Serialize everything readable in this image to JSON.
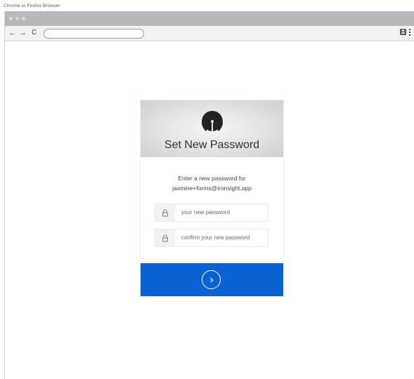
{
  "caption": "Chrome or Firefox Browser",
  "browser": {
    "nav": {
      "back": "←",
      "forward": "→",
      "reload": "C"
    },
    "url": ""
  },
  "card": {
    "title": "Set New Password",
    "desc_line1": "Enter a new password for",
    "desc_line2": "jasmine+forms@ironsight.app",
    "password_placeholder": "your new password",
    "confirm_placeholder": "confirm your new password"
  },
  "colors": {
    "accent": "#0b62d2",
    "header_bg": "#dcdcdc",
    "titlebar": "#b6b8bd"
  },
  "icons": [
    "lock-icon",
    "lock-icon",
    "chevron-right-icon",
    "logo-icon",
    "profile-icon",
    "kebab-menu-icon"
  ]
}
